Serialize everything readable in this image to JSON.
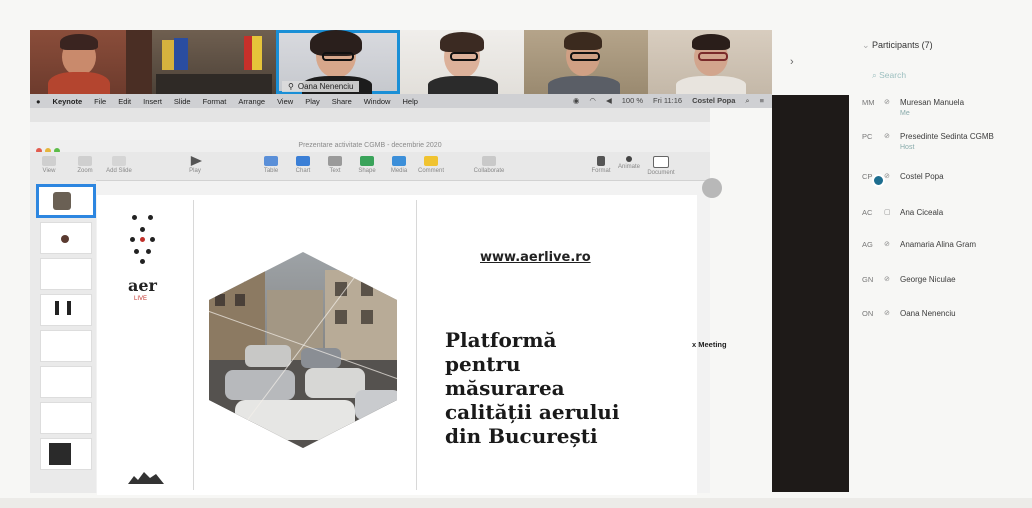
{
  "video_tiles": [
    {
      "name": ""
    },
    {
      "name": "Oana Nenenciu"
    },
    {
      "name": ""
    },
    {
      "name": ""
    },
    {
      "name": ""
    }
  ],
  "menubar": {
    "items": [
      "Keynote",
      "File",
      "Edit",
      "Insert",
      "Slide",
      "Format",
      "Arrange",
      "View",
      "Play",
      "Share",
      "Window",
      "Help"
    ],
    "battery": "100 %",
    "clock": "Fri 11:16",
    "user": "Costel Popa"
  },
  "keynote": {
    "window_title": "Prezentare activitate CGMB - decembrie 2020",
    "toolbar": {
      "view": "View",
      "zoom": "Zoom",
      "add_slide": "Add Slide",
      "play": "Play",
      "table": "Table",
      "chart": "Chart",
      "text": "Text",
      "shape": "Shape",
      "media": "Media",
      "comment": "Comment",
      "collaborate": "Collaborate",
      "format": "Format",
      "animate": "Animate",
      "document": "Document"
    },
    "thumbnails": [
      1,
      2,
      3,
      4,
      5,
      6,
      7,
      8
    ]
  },
  "slide": {
    "logo_text": "aer",
    "logo_sub": "LIVE",
    "url": "www.aerlive.ro",
    "title_lines": [
      "Platformă",
      "pentru",
      "măsurarea",
      "calității aerului",
      "din București"
    ]
  },
  "meeting_label": "x Meeting",
  "participants": {
    "header": "Participants (7)",
    "search_placeholder": "Search",
    "list": [
      {
        "initials": "MM",
        "name": "Muresan Manuela",
        "sub": "Me"
      },
      {
        "initials": "PC",
        "name": "Presedinte Sedinta CGMB",
        "sub": "Host"
      },
      {
        "initials": "CP",
        "name": "Costel Popa",
        "sub": ""
      },
      {
        "initials": "AC",
        "name": "Ana Ciceala",
        "sub": ""
      },
      {
        "initials": "AG",
        "name": "Anamaria Alina Gram",
        "sub": ""
      },
      {
        "initials": "GN",
        "name": "George Niculae",
        "sub": ""
      },
      {
        "initials": "ON",
        "name": "Oana Nenenciu",
        "sub": ""
      }
    ]
  },
  "colors": {
    "accent_blue": "#2d86e0",
    "slide_dot_red": "#c0302a",
    "dark_column": "#1e1a18"
  }
}
